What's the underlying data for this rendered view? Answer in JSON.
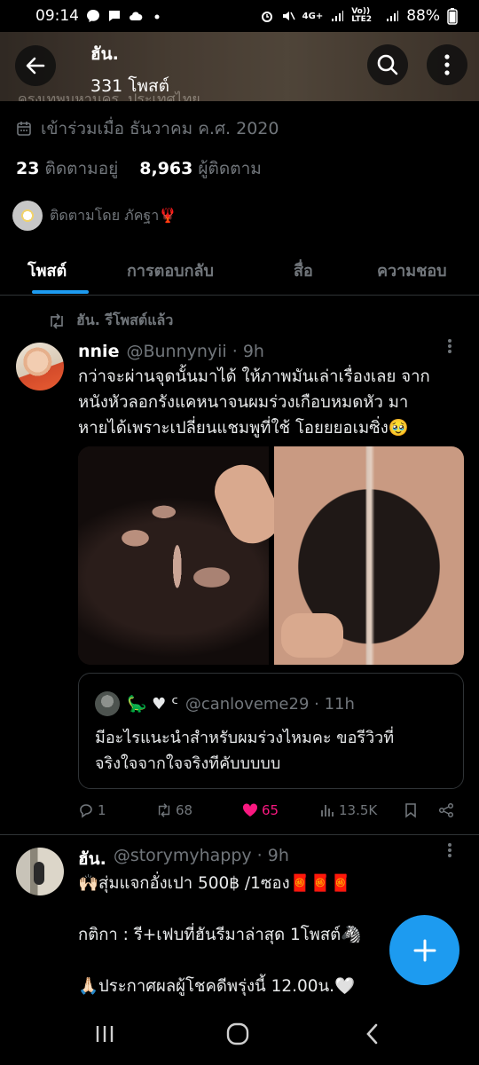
{
  "status_bar": {
    "time": "09:14",
    "network": "4G+",
    "volte": "Vo)) LTE2",
    "battery": "88%"
  },
  "header": {
    "title": "ฮัน.",
    "subtitle": "331 โพสต์",
    "ghost_text": "ครุงเทพมหานคร, ประเทศไทย"
  },
  "profile": {
    "joined": "เข้าร่วมเมื่อ ธันวาคม ค.ศ. 2020",
    "following_count": "23",
    "following_label": "ติดตามอยู่",
    "followers_count": "8,963",
    "followers_label": "ผู้ติดตาม",
    "followed_by": "ติดตามโดย ภัคฐา🦞"
  },
  "tabs": [
    "โพสต์",
    "การตอบกลับ",
    "สื่อ",
    "ความชอบ"
  ],
  "repost_label": "ฮัน. รีโพสต์แล้ว",
  "tweet1": {
    "name": "nnie",
    "meta": "@Bunnynyii · 9h",
    "text": "กว่าจะผ่านจุดนั้นมาได้ ให้ภาพมันเล่าเรื่องเลย จาก\nหนังหัวลอกรังแคหนาจนผมร่วงเกือบหมดหัว มา\nหายได้เพราะเปลี่ยนแชมพูที่ใช้ โอยยยอเมซิ่ง🥹",
    "quote": {
      "name": "🦕 ♥ ᑦ",
      "meta": "@canloveme29 · 11h",
      "text": "มีอะไรแนะนำสำหรับผมร่วงไหมคะ ขอรีวิวที่\nจริงใจจากใจจริงทีคับบบบบ"
    },
    "actions": {
      "replies": "1",
      "reposts": "68",
      "likes": "65",
      "views": "13.5K"
    }
  },
  "tweet2": {
    "name": "ฮัน.",
    "meta": "@storymyhappy · 9h",
    "text": "🙌🏻สุ่มแจกอั่งเปา 500฿ /1ซอง🧧🧧🧧\n\nกติกา : รี+เฟบที่ฮันรีมาล่าสุด 1โพสต์🦓\n\n🙏🏻ประกาศผลผู้โชคดีพรุ่งนี้ 12.00น.🤍"
  },
  "colors": {
    "accent": "#1d9bf0",
    "like": "#f91880",
    "muted": "#71767b",
    "background": "#000000"
  }
}
